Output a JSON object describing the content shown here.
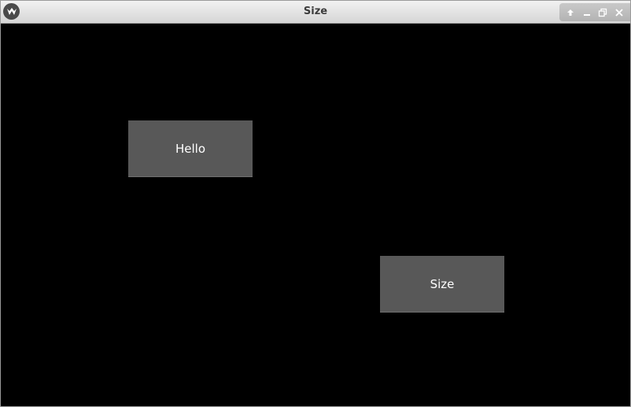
{
  "window": {
    "title": "Size",
    "controls": [
      "shade-icon",
      "minimize-icon",
      "maximize-icon",
      "close-icon"
    ]
  },
  "buttons": {
    "hello_label": "Hello",
    "size_label": "Size"
  },
  "colors": {
    "background": "#000000",
    "button": "#585858",
    "button_text": "#ffffff"
  }
}
